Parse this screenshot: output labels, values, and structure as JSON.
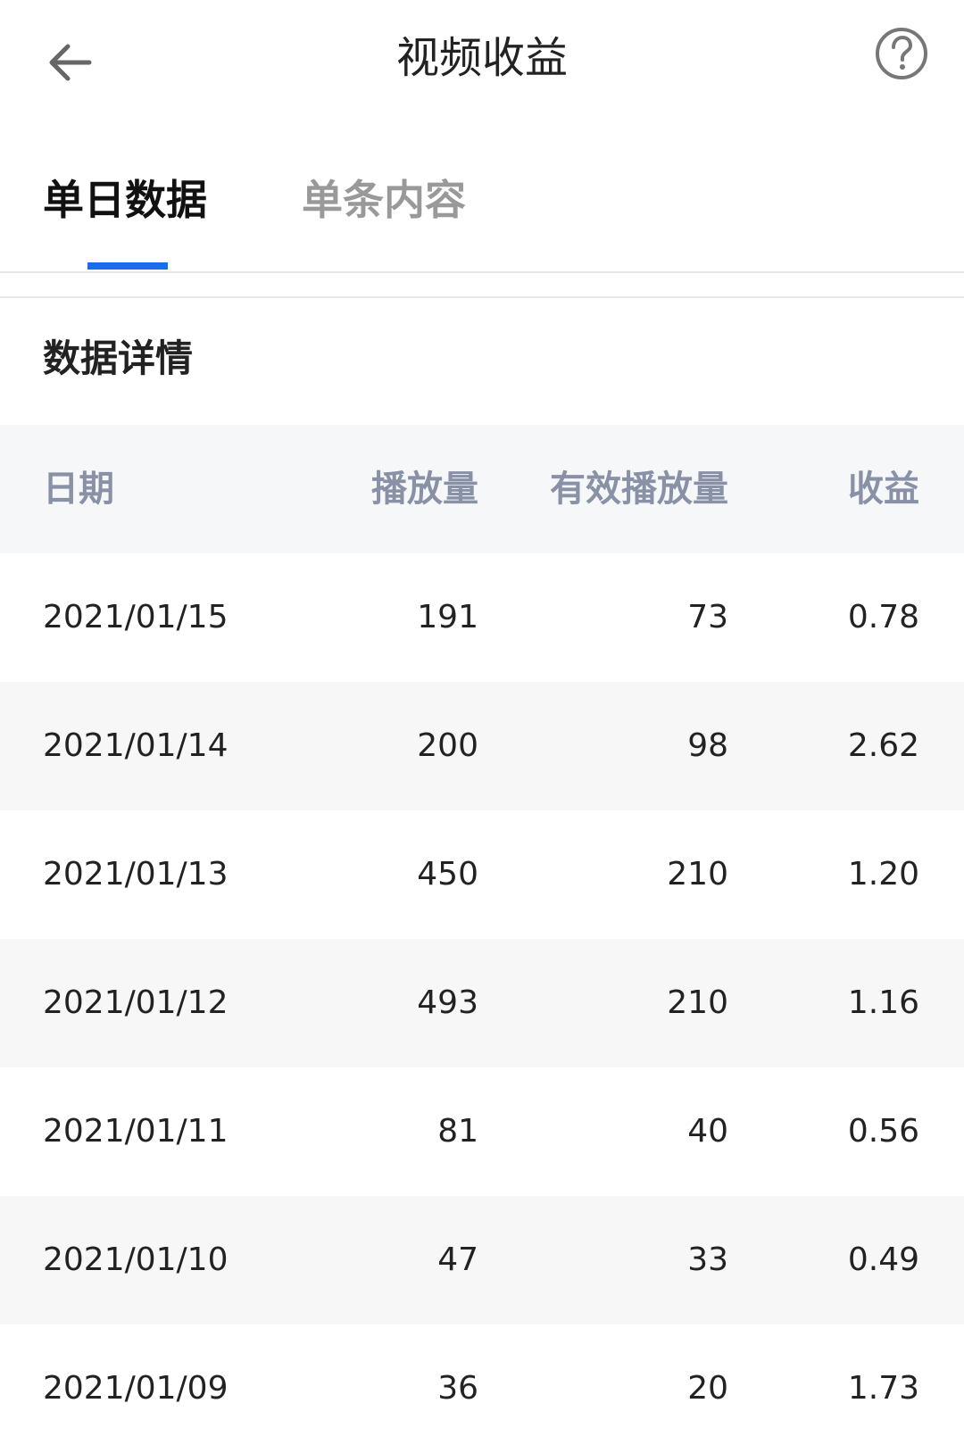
{
  "header": {
    "title": "视频收益",
    "back_icon": "arrow-left-icon",
    "help_icon": "question-circle-icon"
  },
  "tabs": [
    {
      "label": "单日数据",
      "active": true
    },
    {
      "label": "单条内容",
      "active": false
    }
  ],
  "colors": {
    "accent": "#1a6bf0",
    "header_text": "#8891a5",
    "inactive_tab": "#999999"
  },
  "section": {
    "title": "数据详情"
  },
  "table": {
    "columns": [
      "日期",
      "播放量",
      "有效播放量",
      "收益"
    ],
    "rows": [
      {
        "date": "2021/01/15",
        "plays": "191",
        "valid_plays": "73",
        "income": "0.78"
      },
      {
        "date": "2021/01/14",
        "plays": "200",
        "valid_plays": "98",
        "income": "2.62"
      },
      {
        "date": "2021/01/13",
        "plays": "450",
        "valid_plays": "210",
        "income": "1.20"
      },
      {
        "date": "2021/01/12",
        "plays": "493",
        "valid_plays": "210",
        "income": "1.16"
      },
      {
        "date": "2021/01/11",
        "plays": "81",
        "valid_plays": "40",
        "income": "0.56"
      },
      {
        "date": "2021/01/10",
        "plays": "47",
        "valid_plays": "33",
        "income": "0.49"
      },
      {
        "date": "2021/01/09",
        "plays": "36",
        "valid_plays": "20",
        "income": "1.73"
      }
    ]
  }
}
